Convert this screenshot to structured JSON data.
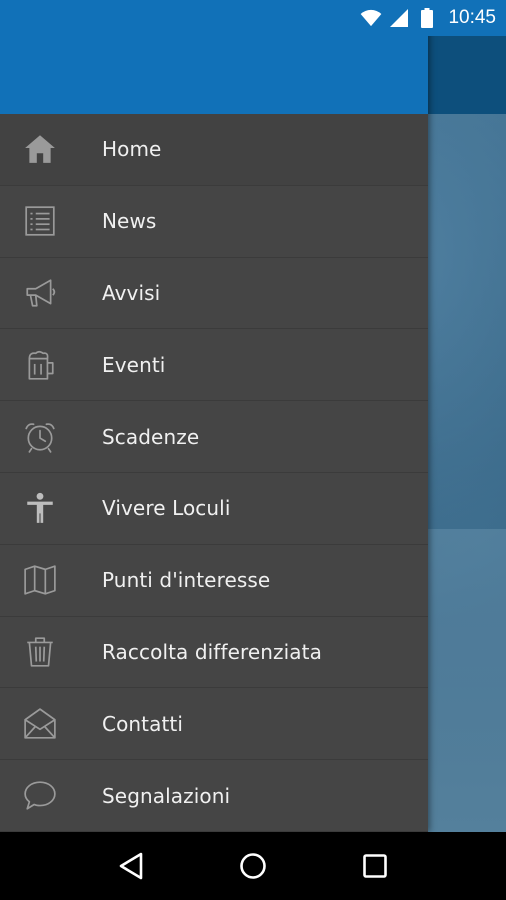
{
  "status_bar": {
    "time": "10:45",
    "icons": [
      "wifi-icon",
      "cell-signal-icon",
      "battery-icon"
    ]
  },
  "theme": {
    "primary": "#1171b8",
    "drawer_bg": "#454545",
    "text": "#f0f0f0"
  },
  "menu": {
    "items": [
      {
        "label": "Home",
        "icon": "home-icon"
      },
      {
        "label": "News",
        "icon": "list-icon"
      },
      {
        "label": "Avvisi",
        "icon": "megaphone-icon"
      },
      {
        "label": "Eventi",
        "icon": "beer-mug-icon"
      },
      {
        "label": "Scadenze",
        "icon": "alarm-clock-icon"
      },
      {
        "label": "Vivere Loculi",
        "icon": "person-icon"
      },
      {
        "label": "Punti d'interesse",
        "icon": "map-icon"
      },
      {
        "label": "Raccolta differenziata",
        "icon": "trash-icon"
      },
      {
        "label": "Contatti",
        "icon": "envelope-icon"
      },
      {
        "label": "Segnalazioni",
        "icon": "chat-bubble-icon"
      }
    ]
  },
  "nav_bar": {
    "buttons": [
      "back-icon",
      "home-circle-icon",
      "recents-icon"
    ]
  }
}
